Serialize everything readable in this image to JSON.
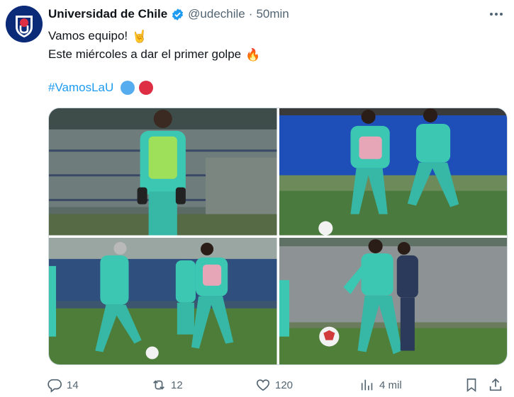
{
  "tweet": {
    "author": {
      "display_name": "Universidad de Chile",
      "handle": "@udechile",
      "verified": true,
      "time": "50min",
      "separator": "·"
    },
    "text": {
      "line1": "Vamos equipo!",
      "line1_emoji": "🤘",
      "line2": "Este miércoles a dar el primer golpe",
      "line2_emoji": "🔥"
    },
    "hashtag": "#VamosLaU",
    "club_colors": [
      "#55acee",
      "#dd2e44"
    ],
    "media": {
      "count": 4,
      "type": "photo-grid"
    },
    "actions": {
      "replies": "14",
      "reposts": "12",
      "likes": "120",
      "views": "4 mil"
    }
  },
  "colors": {
    "text_primary": "#0f1419",
    "text_secondary": "#536471",
    "link": "#1d9bf0",
    "verified_badge": "#1d9bf0",
    "border": "#cfd9de"
  }
}
